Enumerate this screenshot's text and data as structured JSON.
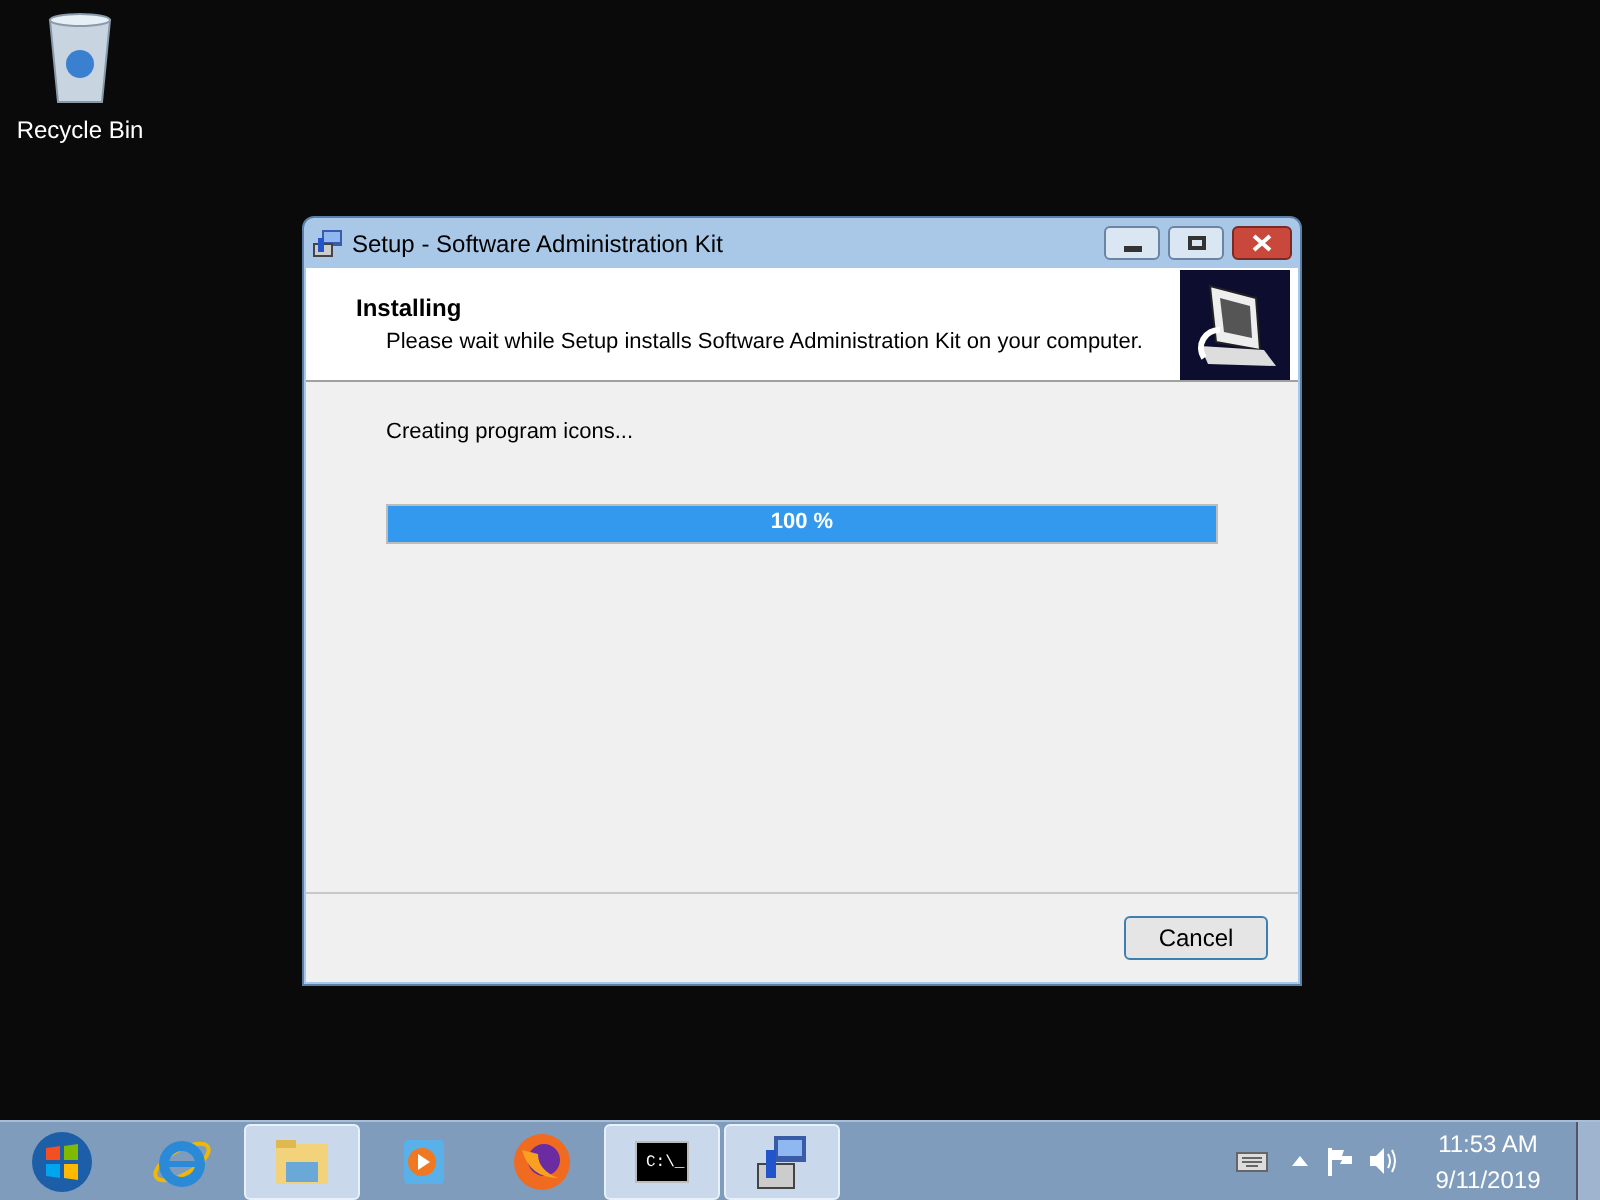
{
  "desktop": {
    "icons": [
      {
        "label": "Recycle Bin"
      }
    ]
  },
  "window": {
    "title": "Setup - Software Administration Kit",
    "header": {
      "title": "Installing",
      "subtitle": "Please wait while Setup installs Software Administration Kit on your computer."
    },
    "status": "Creating program icons...",
    "progress": {
      "level": 1,
      "reading": "100 %"
    },
    "buttons": [
      "Cancel"
    ]
  },
  "taskbar": {
    "items": [
      {
        "kind": "start",
        "selected": false
      },
      {
        "kind": "ie",
        "selected": false
      },
      {
        "kind": "explorer",
        "selected": true
      },
      {
        "kind": "media",
        "selected": false
      },
      {
        "kind": "firefox",
        "selected": false
      },
      {
        "kind": "cmd",
        "selected": true,
        "glyph": "C:\\_"
      },
      {
        "kind": "setup",
        "selected": true
      }
    ],
    "clock": {
      "time": "11:53 AM",
      "date": "9/11/2019"
    }
  }
}
